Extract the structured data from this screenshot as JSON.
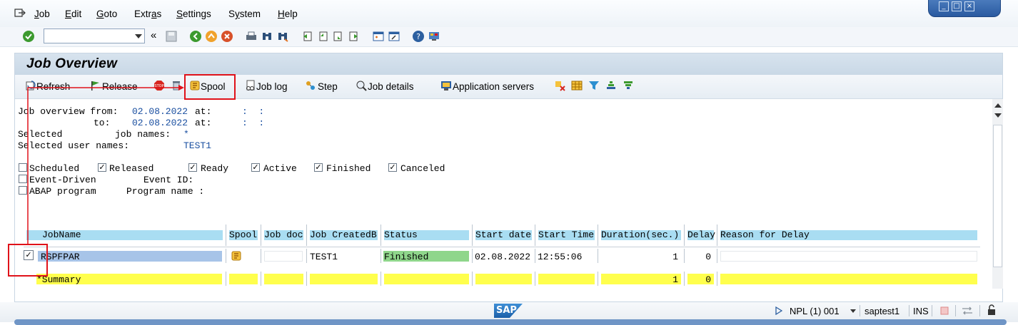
{
  "menu": {
    "items": [
      "Job",
      "Edit",
      "Goto",
      "Extras",
      "Settings",
      "System",
      "Help"
    ],
    "underline": [
      "J",
      "E",
      "G",
      "a",
      "S",
      "y",
      "H"
    ]
  },
  "standard_toolbar": {
    "command_value": "",
    "icons": [
      "enter-icon",
      "back-icon",
      "exit-icon",
      "cancel-icon",
      "print-icon",
      "find-icon",
      "find-next-icon",
      "first-page-icon",
      "previous-page-icon",
      "next-page-icon",
      "last-page-icon",
      "create-session-icon",
      "shortcut-icon",
      "help-icon",
      "customize-layout-icon"
    ]
  },
  "page": {
    "title": "Job Overview"
  },
  "app_toolbar": {
    "refresh": "Refresh",
    "release": "Release",
    "spool": "Spool",
    "job_log": "Job log",
    "step": "Step",
    "job_details": "Job details",
    "application_servers": "Application servers"
  },
  "selection": {
    "overview_from_label": "Job overview from:",
    "from_date": "02.08.2022",
    "at_label": "at:",
    "from_time": ":  :",
    "to_label": "to:",
    "to_date": "02.08.2022",
    "to_time": ":  :",
    "selected_label": "Selected",
    "job_names_label": "job names:",
    "job_names_value": "*",
    "user_names_label": "Selected user names:",
    "user_names_value": "TEST1"
  },
  "status_filters": [
    {
      "label": "Scheduled",
      "checked": false
    },
    {
      "label": "Released",
      "checked": true
    },
    {
      "label": "Ready",
      "checked": true
    },
    {
      "label": "Active",
      "checked": true
    },
    {
      "label": "Finished",
      "checked": true
    },
    {
      "label": "Canceled",
      "checked": true
    }
  ],
  "event": {
    "label": "Event-Driven",
    "checked": false,
    "event_id_label": "Event ID:"
  },
  "abap": {
    "label": "ABAP program",
    "checked": false,
    "program_name_label": "Program name :"
  },
  "table": {
    "columns": [
      "JobName",
      "Spool",
      "Job doc",
      "Job CreatedB",
      "Status",
      "Start date",
      "Start Time",
      "Duration(sec.)",
      "Delay",
      "Reason for Delay"
    ],
    "rows": [
      {
        "selected": true,
        "job_name": "RSPFPAR",
        "spool": "spool-icon",
        "job_doc": "",
        "created_by": "TEST1",
        "status": "Finished",
        "start_date": "02.08.2022",
        "start_time": "12:55:06",
        "duration": "1",
        "delay": "0",
        "reason": ""
      }
    ],
    "summary": {
      "label": "*Summary",
      "duration": "1",
      "delay": "0"
    }
  },
  "statusbar": {
    "system": "NPL (1) 001",
    "host": "saptest1",
    "mode": "INS"
  },
  "colors": {
    "header_fill": "#a9ddf2",
    "status_finished": "#8fd68b",
    "summary_fill": "#ffff4d",
    "selected_row": "#a7c4e8",
    "highlight": "#e0121a"
  }
}
